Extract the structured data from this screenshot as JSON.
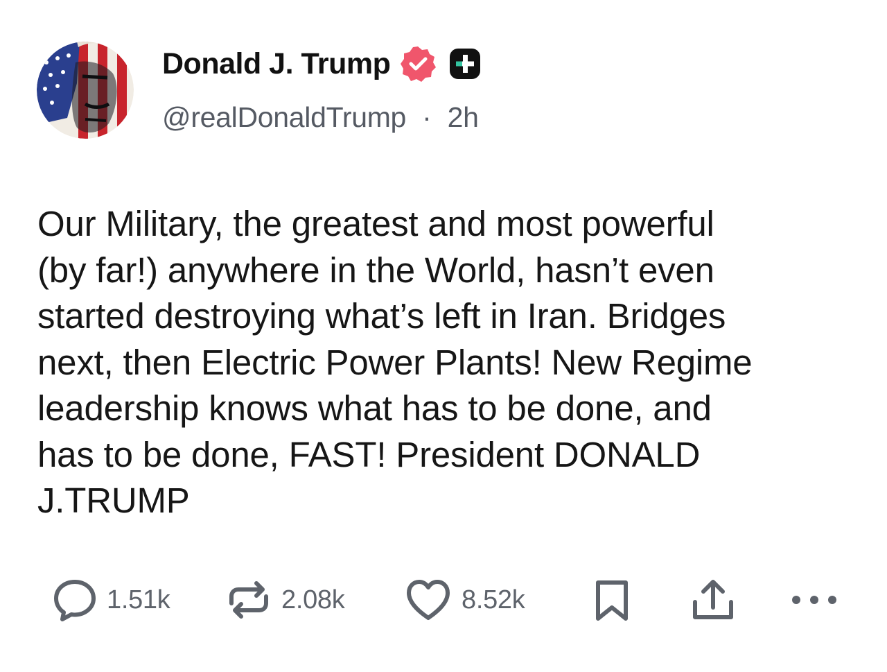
{
  "author": {
    "display_name": "Donald J. Trump",
    "handle": "@realDonaldTrump",
    "separator": "·",
    "time_ago": "2h",
    "verified_badge_color": "#f0566c",
    "plus_badge_color": "#111111"
  },
  "post": {
    "text": "Our Military, the greatest and most powerful\n(by far!) anywhere in the World, hasn’t even\nstarted destroying what’s left in Iran. Bridges\nnext, then Electric Power Plants! New Regime\nleadership knows what has to be done, and\nhas to be done, FAST! President DONALD\nJ.TRUMP"
  },
  "actions": {
    "replies": "1.51k",
    "reposts": "2.08k",
    "likes": "8.52k",
    "icon_color": "#5e636b"
  },
  "icons": {
    "reply": "speech-bubble-icon",
    "repost": "repost-arrows-icon",
    "like": "heart-icon",
    "bookmark": "bookmark-icon",
    "share": "share-upload-icon",
    "more": "more-dots-icon"
  }
}
